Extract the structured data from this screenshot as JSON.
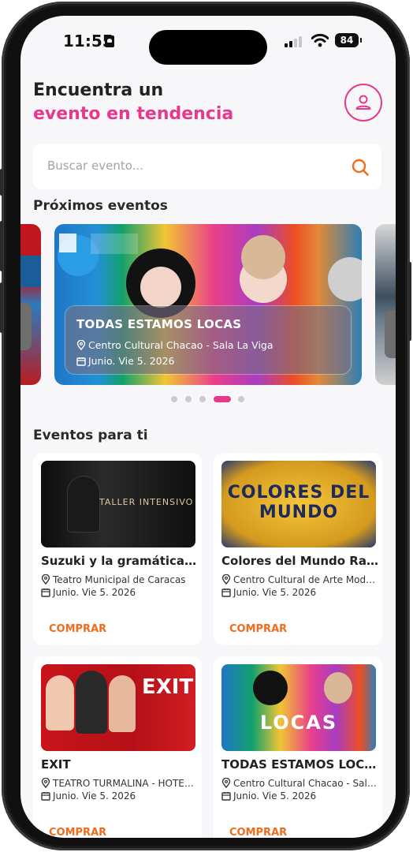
{
  "status_bar": {
    "time": "11:55",
    "battery": "84"
  },
  "header": {
    "line1": "Encuentra un",
    "line2": "evento en tendencia"
  },
  "search": {
    "placeholder": "Buscar evento..."
  },
  "sections": {
    "upcoming": "Próximos eventos",
    "for_you": "Eventos para ti"
  },
  "featured": {
    "title": "TODAS ESTAMOS LOCAS",
    "venue": "Centro Cultural Chacao - Sala La Viga",
    "date": "Junio. Vie 5. 2026"
  },
  "carousel": {
    "count": 5,
    "active_index": 3
  },
  "events": [
    {
      "title": "Suzuki y la gramática de los pies",
      "venue": "Teatro Municipal de Caracas",
      "date": "Junio. Vie 5. 2026",
      "buy": "COMPRAR",
      "poster_text": "TALLER INTENSIVO SUZU"
    },
    {
      "title": "Colores del Mundo   Ravahil X Cayiao",
      "venue": "Centro Cultural de Arte Moderno",
      "date": "Junio. Vie 5. 2026",
      "buy": "COMPRAR",
      "poster_text": "COLORES DEL MUNDO"
    },
    {
      "title": "EXIT",
      "venue": "TEATRO TURMALINA - HOTEL EUROBUILDING",
      "date": "Junio. Vie 5. 2026",
      "buy": "COMPRAR",
      "poster_text": "EXIT"
    },
    {
      "title": "TODAS ESTAMOS LOCAS",
      "venue": "Centro Cultural Chacao - Sala La Viga",
      "date": "Junio. Vie 5. 2026",
      "buy": "COMPRAR",
      "poster_text": "LOCAS"
    }
  ],
  "colors": {
    "accent_pink": "#e6398e",
    "accent_orange": "#f06b1c",
    "background": "#f7f6f9"
  }
}
